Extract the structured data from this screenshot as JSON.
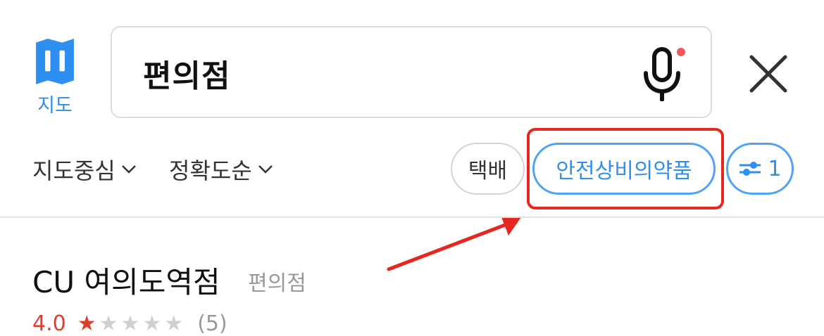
{
  "header": {
    "map_label": "지도",
    "search_value": "편의점"
  },
  "sort": {
    "center_label": "지도중심",
    "accuracy_label": "정확도순"
  },
  "chips": {
    "delivery": "택배",
    "safe_medicine": "안전상비의약품",
    "filter_count": "1"
  },
  "result": {
    "name": "CU 여의도역점",
    "category": "편의점",
    "rating": "4.0",
    "stars_filled": "★",
    "stars_empty": "★★★★",
    "review_count": "(5)"
  },
  "colors": {
    "accent": "#2f8ff0",
    "highlight": "#e5271f",
    "mic_dot": "#f05a5a"
  },
  "icons": {
    "map": "map-icon",
    "mic": "microphone-icon",
    "close": "close-icon",
    "filter": "sliders-icon"
  }
}
